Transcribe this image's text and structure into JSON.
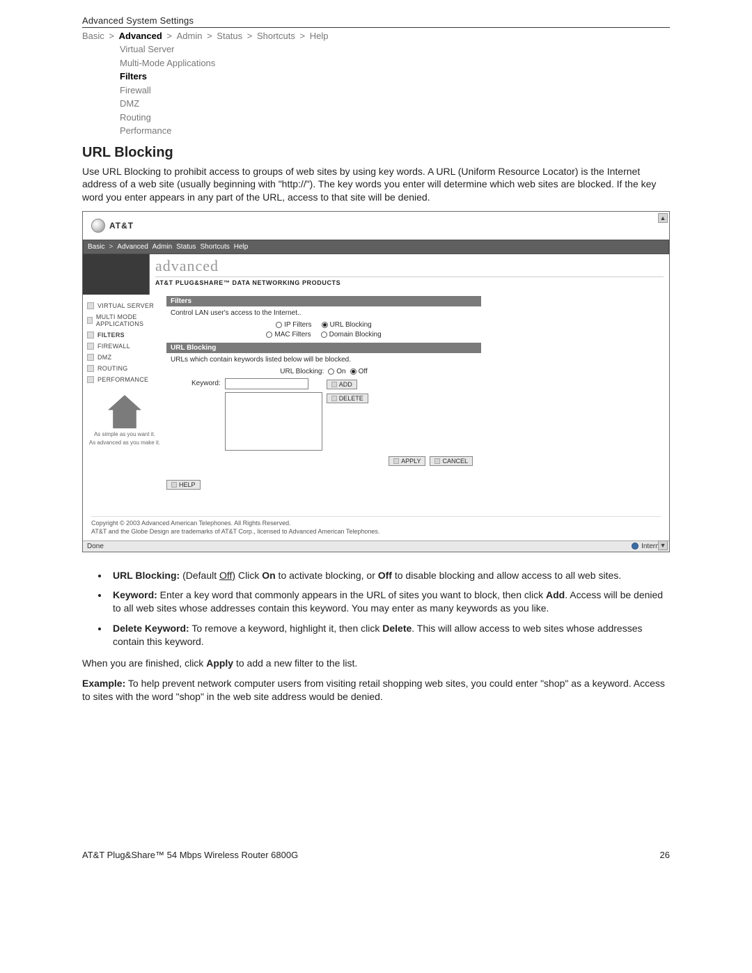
{
  "page_header": "Advanced System Settings",
  "breadcrumbs": [
    "Basic",
    "Advanced",
    "Admin",
    "Status",
    "Shortcuts",
    "Help"
  ],
  "breadcrumbs_active_index": 1,
  "subnav": [
    "Virtual Server",
    "Multi-Mode Applications",
    "Filters",
    "Firewall",
    "DMZ",
    "Routing",
    "Performance"
  ],
  "subnav_active_index": 2,
  "section_title": "URL Blocking",
  "section_intro": "Use URL Blocking to prohibit access to groups of web sites by using key words. A URL (Uniform Resource Locator) is the Internet address of a web site (usually beginning with \"http://\"). The key words you enter will determine which web sites are blocked. If the key word you enter appears in any part of the URL, access to that site will be denied.",
  "screenshot": {
    "logo_text": "AT&T",
    "topnav": [
      "Basic",
      ">",
      "Advanced",
      "Admin",
      "Status",
      "Shortcuts",
      "Help"
    ],
    "banner_title": "advanced",
    "banner_subtitle": "AT&T PLUG&SHARE™ DATA NETWORKING PRODUCTS",
    "sidebar": [
      "VIRTUAL SERVER",
      "MULTI MODE APPLICATIONS",
      "FILTERS",
      "FIREWALL",
      "DMZ",
      "ROUTING",
      "PERFORMANCE"
    ],
    "sidebar_active_index": 2,
    "house_tag1": "As simple as you want it.",
    "house_tag2": "As advanced as you make it.",
    "filters_header": "Filters",
    "filters_desc": "Control LAN user's access to the Internet..",
    "radio_row1": [
      {
        "label": "IP Filters",
        "checked": false
      },
      {
        "label": "URL Blocking",
        "checked": true
      }
    ],
    "radio_row2": [
      {
        "label": "MAC Filters",
        "checked": false
      },
      {
        "label": "Domain Blocking",
        "checked": false
      }
    ],
    "urlblock_header": "URL Blocking",
    "urlblock_desc": "URLs which contain keywords listed below will be blocked.",
    "urlblock_label": "URL Blocking:",
    "onoff": [
      {
        "label": "On",
        "checked": false
      },
      {
        "label": "Off",
        "checked": true
      }
    ],
    "keyword_label": "Keyword:",
    "btn_add": "ADD",
    "btn_delete": "DELETE",
    "btn_apply": "APPLY",
    "btn_cancel": "CANCEL",
    "btn_help": "HELP",
    "copyright1": "Copyright © 2003 Advanced American Telephones. All Rights Reserved.",
    "copyright2": "AT&T and the Globe Design are trademarks of AT&T Corp., licensed to Advanced American Telephones.",
    "statusbar_left": "Done",
    "statusbar_right": "Internet"
  },
  "bullets": [
    {
      "label": "URL Blocking:",
      "text_pre": " (Default ",
      "text_underlined": "Off)",
      "text_mid": " Click ",
      "b1": "On",
      "text_mid2": " to activate blocking, or ",
      "b2": "Off",
      "text_post": " to disable blocking and allow access to all web sites."
    },
    {
      "label": "Keyword:",
      "text": " Enter a key word that commonly appears in the URL of sites you want to block, then click ",
      "b1": "Add",
      "text2": ". Access will be denied to all web sites whose addresses contain this keyword. You may enter as many keywords as you like."
    },
    {
      "label": "Delete Keyword:",
      "text": " To remove a keyword, highlight it, then click ",
      "b1": "Delete",
      "text2": ". This will allow access to web sites whose addresses contain this keyword."
    }
  ],
  "finish_text_pre": "When you are finished, click ",
  "finish_bold": "Apply",
  "finish_text_post": " to add a new filter to the list.",
  "example_label": "Example:",
  "example_text": " To help prevent network computer users from visiting retail shopping web sites, you could enter \"shop\" as a keyword. Access to sites with the word \"shop\" in the web site address would be denied.",
  "footer_left": "AT&T Plug&Share™ 54 Mbps Wireless Router 6800G",
  "footer_right": "26"
}
